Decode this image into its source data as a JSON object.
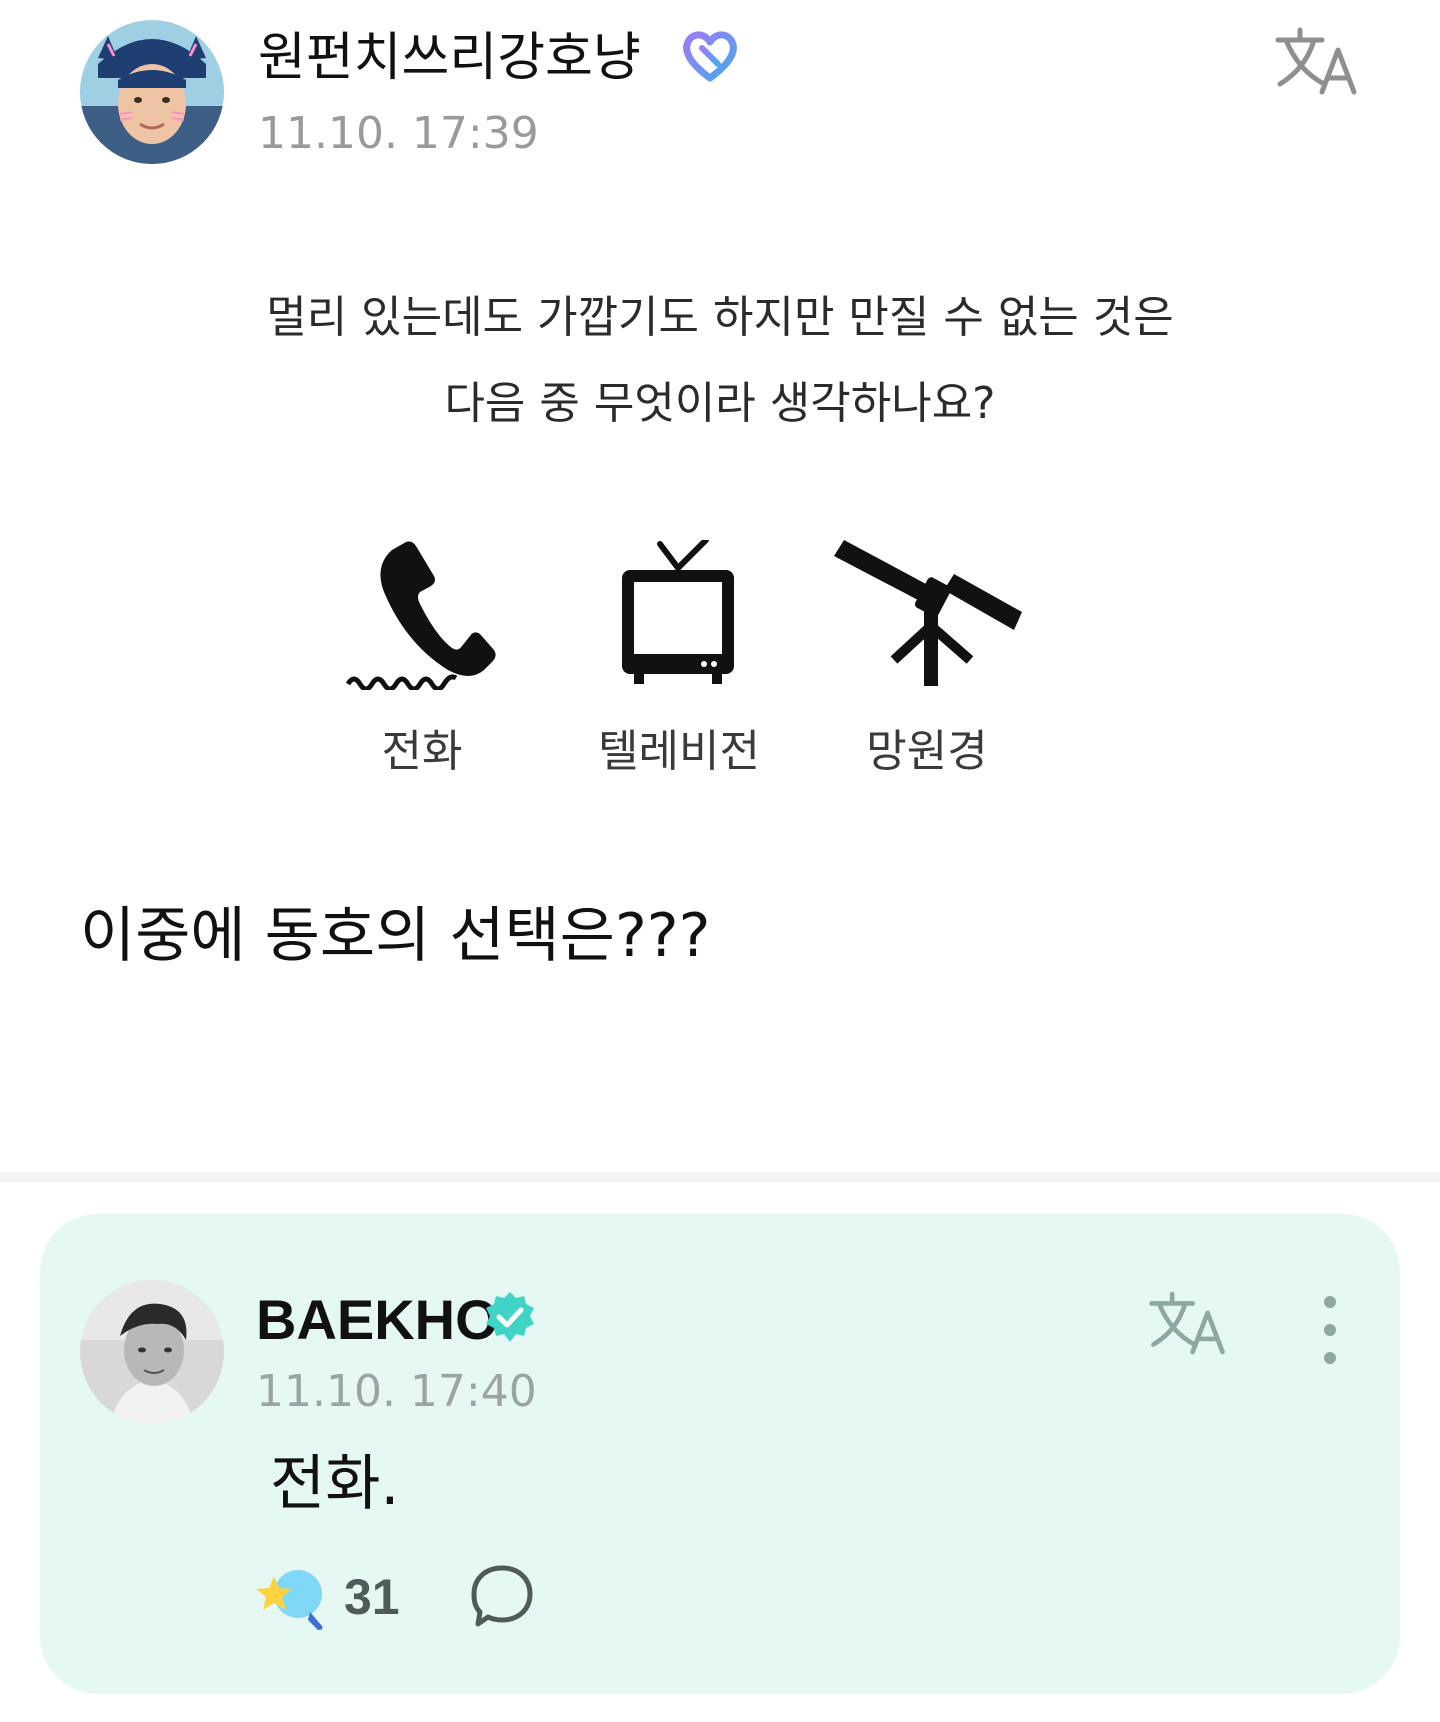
{
  "post": {
    "author": "원펀치쓰리강호냥",
    "timestamp": "11.10. 17:39",
    "badge_icon": "fan-heart-badge-icon",
    "translate_icon": "translate-icon",
    "quiz": {
      "question_line_1": "멀리 있는데도 가깝기도 하지만 만질 수 없는 것은",
      "question_line_2": "다음 중 무엇이라 생각하나요?",
      "options": [
        {
          "icon": "telephone-icon",
          "label": "전화"
        },
        {
          "icon": "television-icon",
          "label": "텔레비전"
        },
        {
          "icon": "telescope-icon",
          "label": "망원경"
        }
      ]
    },
    "body": "이중에 동호의 선택은???"
  },
  "reply": {
    "author": "BAEKHO",
    "verified_icon": "verified-badge-icon",
    "timestamp": "11.10. 17:40",
    "body": "전화.",
    "likes": "31",
    "translate_icon": "translate-icon",
    "more_icon": "more-vertical-icon",
    "like_icon": "like-icon",
    "comment_icon": "comment-icon"
  },
  "colors": {
    "reply_card_background": "#e6f8f4",
    "verified_accent": "#3fd4c6",
    "timestamp_gray": "#9a9a9a",
    "fan_badge_purple": "#7b6cf0"
  }
}
